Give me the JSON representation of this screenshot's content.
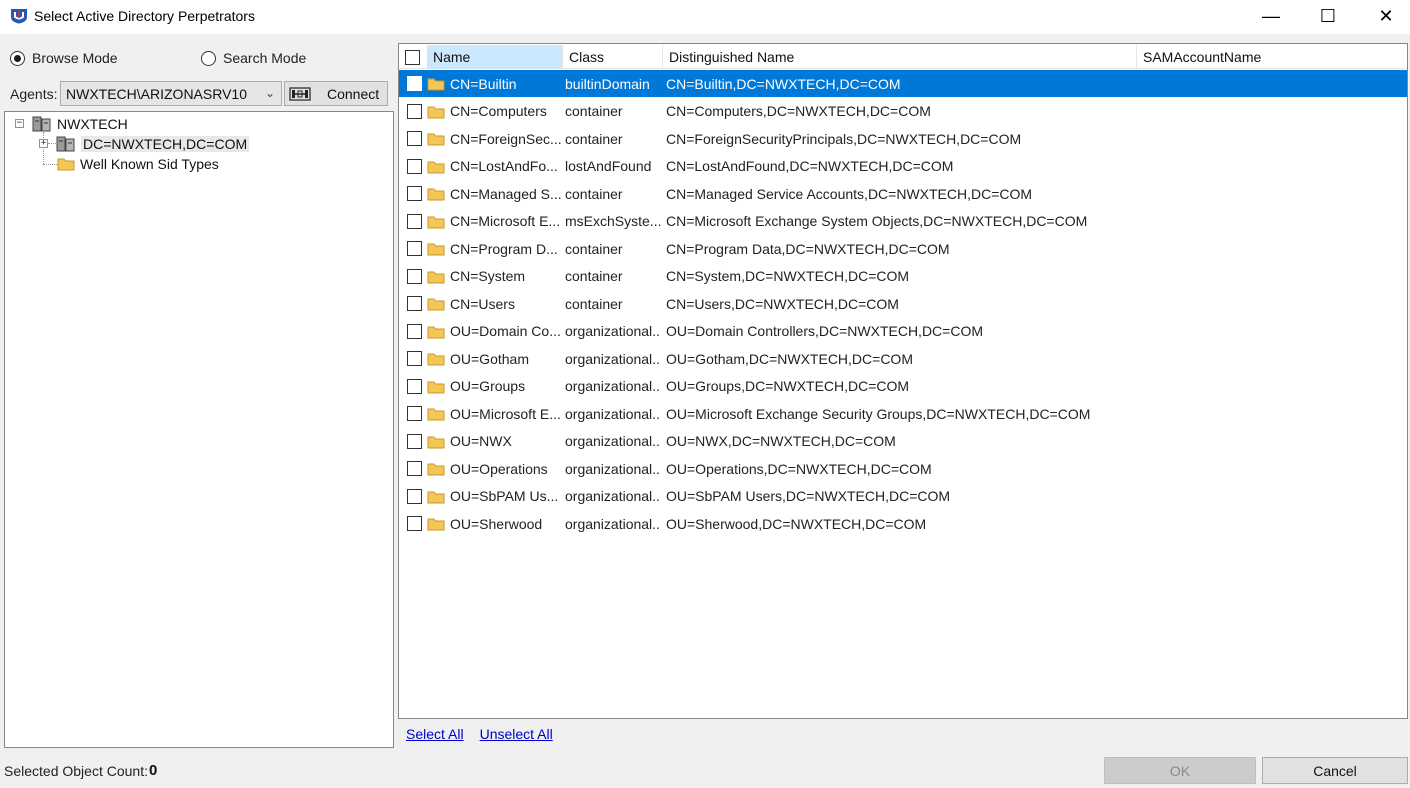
{
  "window": {
    "title": "Select Active Directory Perpetrators",
    "minimize_glyph": "—",
    "maximize_glyph": "☐",
    "close_glyph": "✕",
    "icon": "app-shield-icon"
  },
  "mode": {
    "browse_label": "Browse Mode",
    "search_label": "Search Mode",
    "selected": "browse"
  },
  "agents": {
    "label": "Agents:",
    "value": "NWXTECH\\ARIZONASRV10",
    "connect_label": "Connect"
  },
  "tree": {
    "root": "NWXTECH",
    "children": [
      {
        "label": "DC=NWXTECH,DC=COM",
        "selected": true
      },
      {
        "label": "Well Known Sid Types"
      }
    ]
  },
  "list": {
    "columns": [
      "Name",
      "Class",
      "Distinguished Name",
      "SAMAccountName"
    ],
    "rows": [
      {
        "name": "CN=Builtin",
        "class": "builtinDomain",
        "dn": "CN=Builtin,DC=NWXTECH,DC=COM",
        "sam": "",
        "selected": true
      },
      {
        "name": "CN=Computers",
        "class": "container",
        "dn": "CN=Computers,DC=NWXTECH,DC=COM",
        "sam": ""
      },
      {
        "name": "CN=ForeignSec...",
        "class": "container",
        "dn": "CN=ForeignSecurityPrincipals,DC=NWXTECH,DC=COM",
        "sam": ""
      },
      {
        "name": "CN=LostAndFo...",
        "class": "lostAndFound",
        "dn": "CN=LostAndFound,DC=NWXTECH,DC=COM",
        "sam": ""
      },
      {
        "name": "CN=Managed S...",
        "class": "container",
        "dn": "CN=Managed Service Accounts,DC=NWXTECH,DC=COM",
        "sam": ""
      },
      {
        "name": "CN=Microsoft E...",
        "class": "msExchSyste...",
        "dn": "CN=Microsoft Exchange System Objects,DC=NWXTECH,DC=COM",
        "sam": ""
      },
      {
        "name": "CN=Program D...",
        "class": "container",
        "dn": "CN=Program Data,DC=NWXTECH,DC=COM",
        "sam": ""
      },
      {
        "name": "CN=System",
        "class": "container",
        "dn": "CN=System,DC=NWXTECH,DC=COM",
        "sam": ""
      },
      {
        "name": "CN=Users",
        "class": "container",
        "dn": "CN=Users,DC=NWXTECH,DC=COM",
        "sam": ""
      },
      {
        "name": "OU=Domain Co...",
        "class": "organizational...",
        "dn": "OU=Domain Controllers,DC=NWXTECH,DC=COM",
        "sam": ""
      },
      {
        "name": "OU=Gotham",
        "class": "organizational...",
        "dn": "OU=Gotham,DC=NWXTECH,DC=COM",
        "sam": ""
      },
      {
        "name": "OU=Groups",
        "class": "organizational...",
        "dn": "OU=Groups,DC=NWXTECH,DC=COM",
        "sam": ""
      },
      {
        "name": "OU=Microsoft E...",
        "class": "organizational...",
        "dn": "OU=Microsoft Exchange Security Groups,DC=NWXTECH,DC=COM",
        "sam": ""
      },
      {
        "name": "OU=NWX",
        "class": "organizational...",
        "dn": "OU=NWX,DC=NWXTECH,DC=COM",
        "sam": ""
      },
      {
        "name": "OU=Operations",
        "class": "organizational...",
        "dn": "OU=Operations,DC=NWXTECH,DC=COM",
        "sam": ""
      },
      {
        "name": "OU=SbPAM Us...",
        "class": "organizational...",
        "dn": "OU=SbPAM Users,DC=NWXTECH,DC=COM",
        "sam": ""
      },
      {
        "name": "OU=Sherwood",
        "class": "organizational...",
        "dn": "OU=Sherwood,DC=NWXTECH,DC=COM",
        "sam": ""
      }
    ],
    "select_all": "Select All",
    "unselect_all": "Unselect All"
  },
  "status": {
    "label": "Selected Object Count:",
    "count": "0",
    "ok_label": "OK",
    "cancel_label": "Cancel"
  },
  "colors": {
    "selection": "#0078d7",
    "header_active": "#cce8ff",
    "folder": "#f3c655",
    "link": "#0000cc"
  }
}
